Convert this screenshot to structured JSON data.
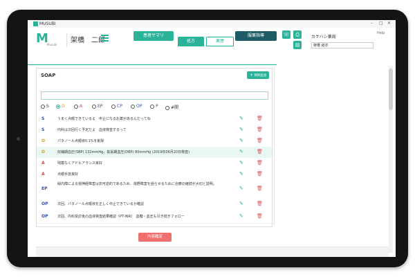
{
  "app": {
    "name": "MUSUBI",
    "logo_letter": "M",
    "logo_text": "Musubi",
    "window_controls": [
      "–",
      "□",
      "✕"
    ]
  },
  "patient": {
    "name": "架橋　二郎"
  },
  "tabs": {
    "summary": "患者サマリ",
    "prescription": "処方",
    "history": "薬歴",
    "guidance": "服薬指導"
  },
  "pharmacy": {
    "name": "カケハシ薬局",
    "staff": "架橋 結衣",
    "help": "Help"
  },
  "soap": {
    "title": "SOAP",
    "add_label": "項目追加",
    "categories": [
      "S",
      "O",
      "A",
      "EP",
      "CP",
      "OP",
      "P",
      "#開"
    ],
    "selected": "O",
    "entries": [
      {
        "tag": "S",
        "color": "#2a4fa0",
        "text": "うまく点眼できているよ　中止になるお薬があるんだってね"
      },
      {
        "tag": "S",
        "color": "#2a4fa0",
        "text": "内科は次回行く予定だよ　血液検査するって"
      },
      {
        "tag": "O",
        "color": "#d4a017",
        "text": "パタノール点眼液0.1%を削除"
      },
      {
        "tag": "O",
        "color": "#d4a017",
        "text": "収縮期血圧(SBP) 132mmHg、拡張期血圧(DBP) 80mmHg (2019年06月20日検査)"
      },
      {
        "tag": "A",
        "color": "#d64545",
        "text": "残薬なくアドヒアランス良好"
      },
      {
        "tag": "A",
        "color": "#d64545",
        "text": "点眼手技良好"
      },
      {
        "tag": "EP",
        "color": "#2a4fa0",
        "text": "緑内障による視神経障害は非可逆的であるため、視野障害を遅らせるために治療の継続が大切と説明。"
      },
      {
        "tag": "OP",
        "color": "#2a4fa0",
        "text": "次回、パタノール点眼液を正しく中止できているか確認"
      },
      {
        "tag": "OP",
        "color": "#2a4fa0",
        "text": "次回、内科受診後の血液検査結果確認（PT-INR）　血糖・血圧も引き続きフォロー"
      }
    ]
  },
  "confirm_label": "内容確定",
  "colors": {
    "accent": "#2bb39a",
    "dark_accent": "#1f5b64",
    "confirm": "#f07070"
  }
}
